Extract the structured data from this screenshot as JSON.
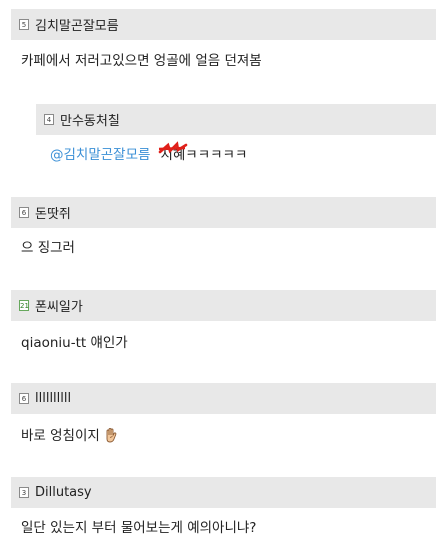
{
  "comments": [
    {
      "level": "5",
      "nick": "김치말곤잘모름",
      "text": "카페에서 저러고있으면 엉골에 얼음 던져봄"
    },
    {
      "level": "4",
      "nick": "만수동처칠",
      "mention": "@김치말곤잘모름",
      "struck": "지혜",
      "text": "ㅋㅋㅋㅋㅋ"
    },
    {
      "level": "6",
      "nick": "돈땃쥐",
      "text": "으 징그러"
    },
    {
      "level": "21",
      "nick": "폰씨일가",
      "text": "qiaoniu-tt 얘인가"
    },
    {
      "level": "6",
      "nick": "llllllllll",
      "text": "바로 엉침이지",
      "emoji": "raised-hand-emoji"
    },
    {
      "level": "3",
      "nick": "Dillutasy",
      "text": "일단 있는지 부터 물어보는게 예의아니냐?"
    }
  ],
  "colors": {
    "header_bg": "#e8e8e8",
    "mention": "#3a8fd6",
    "scribble": "#e0201a"
  }
}
